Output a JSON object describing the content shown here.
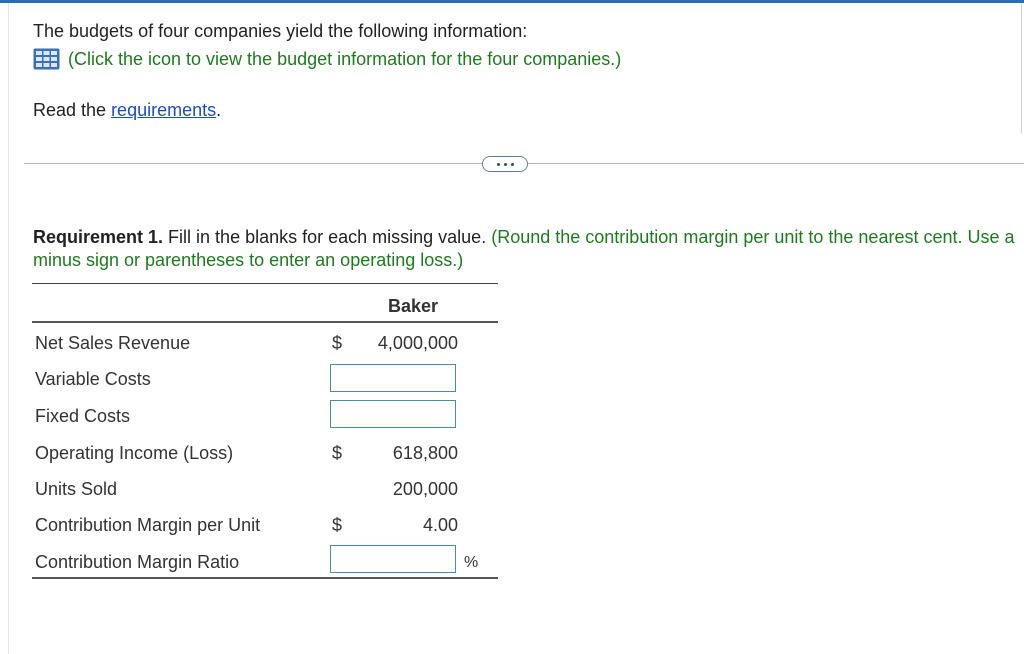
{
  "intro": {
    "text": "The budgets of four companies yield the following information:",
    "icon_link_text": "(Click the icon to view the budget information for the four companies.)"
  },
  "read_line": {
    "prefix": "Read the ",
    "link": "requirements",
    "suffix": "."
  },
  "requirement": {
    "label": "Requirement 1.",
    "text": " Fill in the blanks for each missing value. ",
    "note": "(Round the contribution margin per unit to the nearest cent. Use a minus sign or parentheses to enter an operating loss.)"
  },
  "table": {
    "column_header": "Baker",
    "rows": [
      {
        "label": "Net Sales Revenue",
        "dollar": "$",
        "value": "4,000,000"
      },
      {
        "label": "Variable Costs",
        "input": ""
      },
      {
        "label": "Fixed Costs",
        "input": ""
      },
      {
        "label": "Operating Income (Loss)",
        "dollar": "$",
        "value": "618,800"
      },
      {
        "label": "Units Sold",
        "value": "200,000"
      },
      {
        "label": "Contribution Margin per Unit",
        "dollar": "$",
        "value": "4.00"
      },
      {
        "label": "Contribution Margin Ratio",
        "input": "",
        "suffix": "%"
      }
    ]
  },
  "colors": {
    "accent_bar": "#2a6db0",
    "instruction_green": "#1f7a1f",
    "link_blue": "#1a4dbf",
    "input_border": "#4a8dab",
    "icon_blue": "#3b6fb6"
  },
  "icons": {
    "budget_icon": "grid-table-icon",
    "ellipsis": "more-dots-icon"
  }
}
